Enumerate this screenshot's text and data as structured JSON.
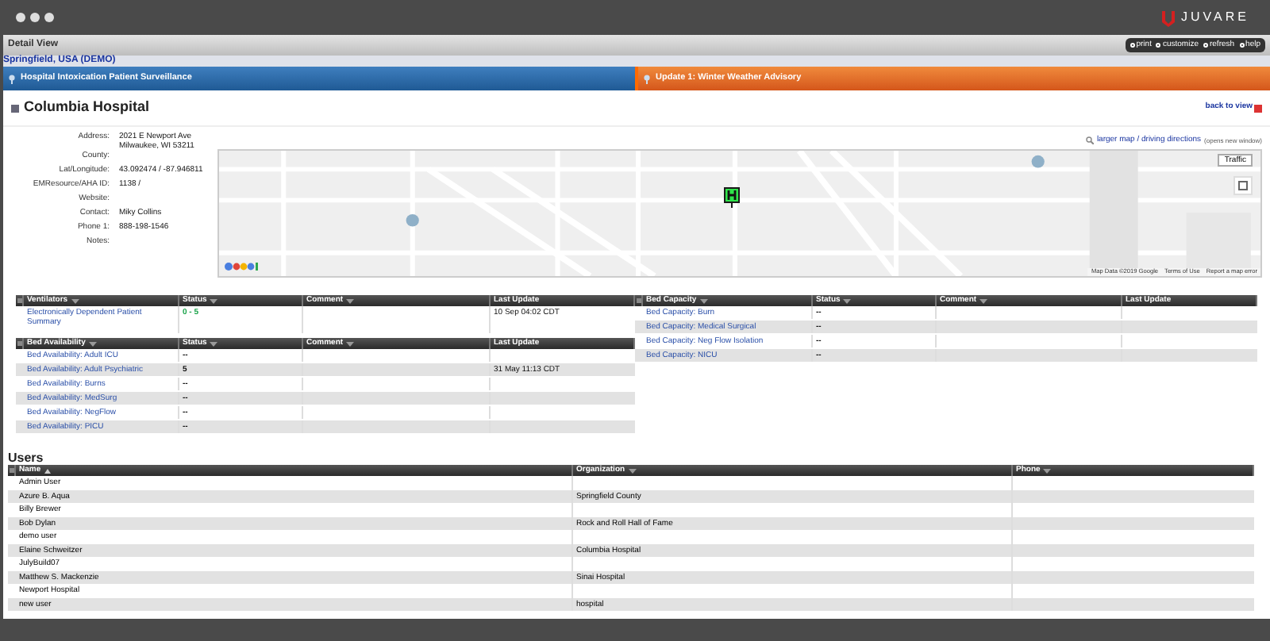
{
  "window": {
    "brand": "JUVARE"
  },
  "toolbar": {
    "title": "Detail View",
    "actions": [
      "print",
      "customize",
      "refresh",
      "help"
    ]
  },
  "region_link": "Springfield, USA (DEMO)",
  "banners": [
    {
      "text": "Hospital Intoxication Patient Surveillance",
      "kind": "event"
    },
    {
      "text": "Update 1: Winter Weather Advisory",
      "kind": "alert"
    }
  ],
  "facility": {
    "name": "Columbia Hospital",
    "back_link": "back to view",
    "fields": [
      {
        "label": "Address:",
        "value": "2021 E Newport Ave\nMilwaukee, WI 53211"
      },
      {
        "label": "County:"
      },
      {
        "label": "Lat/Longitude:",
        "value": "43.092474 / -87.946811"
      },
      {
        "label": "EMResource/AHA ID:",
        "value": "1138 /"
      },
      {
        "label": "Website:"
      },
      {
        "label": "Contact:",
        "value": "Miky Collins"
      },
      {
        "label": "Phone 1:",
        "value": "888-198-1546"
      },
      {
        "label": "Notes:"
      }
    ],
    "map": {
      "link": "larger map / driving directions",
      "link_note": "(opens new window)",
      "traffic_button": "Traffic",
      "footer": [
        "Map Data ©2019 Google",
        "Terms of Use",
        "Report a map error"
      ]
    }
  },
  "tables_left": [
    {
      "columns": [
        {
          "label": "Ventilators",
          "menu": true
        },
        {
          "label": "Status",
          "menu": true
        },
        {
          "label": "Comment",
          "menu": true
        },
        {
          "label": "Last Update",
          "menu": false
        }
      ],
      "rows": [
        {
          "name": "Electronically Dependent Patient Summary",
          "status": "0 - 5",
          "color": "#1aa34a",
          "last_update": "10 Sep 04:02 CDT"
        }
      ]
    },
    {
      "columns": [
        {
          "label": "Bed Availability",
          "menu": true
        },
        {
          "label": "Status",
          "menu": true
        },
        {
          "label": "Comment",
          "menu": true
        },
        {
          "label": "Last Update",
          "menu": false
        }
      ],
      "rows": [
        {
          "name": "Bed Availability: Adult ICU",
          "status": "--",
          "color": "#111111"
        },
        {
          "name": "Bed Availability: Adult Psychiatric",
          "status": "5",
          "color": "#111111",
          "last_update": "31 May 11:13 CDT"
        },
        {
          "name": "Bed Availability: Burns",
          "status": "--",
          "color": "#111111"
        },
        {
          "name": "Bed Availability: MedSurg",
          "status": "--",
          "color": "#111111"
        },
        {
          "name": "Bed Availability: NegFlow",
          "status": "--",
          "color": "#111111"
        },
        {
          "name": "Bed Availability: PICU",
          "status": "--",
          "color": "#111111"
        }
      ]
    }
  ],
  "tables_right": [
    {
      "columns": [
        {
          "label": "Bed Capacity",
          "menu": true
        },
        {
          "label": "Status",
          "menu": true
        },
        {
          "label": "Comment",
          "menu": true
        },
        {
          "label": "Last Update",
          "menu": false
        }
      ],
      "rows": [
        {
          "name": "Bed Capacity: Burn",
          "status": "--",
          "color": "#111111"
        },
        {
          "name": "Bed Capacity: Medical Surgical",
          "status": "--",
          "color": "#111111"
        },
        {
          "name": "Bed Capacity: Neg Flow Isolation",
          "status": "--",
          "color": "#111111"
        },
        {
          "name": "Bed Capacity: NICU",
          "status": "--",
          "color": "#111111"
        }
      ]
    }
  ],
  "users": {
    "title": "Users",
    "columns": [
      {
        "label": "Name",
        "menu": false,
        "sorted": true
      },
      {
        "label": "Organization",
        "menu": true,
        "sorted": false
      },
      {
        "label": "Phone",
        "menu": true,
        "sorted": false
      }
    ],
    "rows": [
      {
        "name": "Admin User"
      },
      {
        "name": "Azure B. Aqua",
        "organization": "Springfield County"
      },
      {
        "name": "Billy Brewer"
      },
      {
        "name": "Bob Dylan",
        "organization": "Rock and Roll Hall of Fame"
      },
      {
        "name": "demo user"
      },
      {
        "name": "Elaine Schweitzer",
        "organization": "Columbia Hospital"
      },
      {
        "name": "JulyBuild07"
      },
      {
        "name": "Matthew S. Mackenzie",
        "organization": "Sinai Hospital"
      },
      {
        "name": "Newport Hospital"
      },
      {
        "name": "new user",
        "organization": "hospital"
      }
    ]
  }
}
